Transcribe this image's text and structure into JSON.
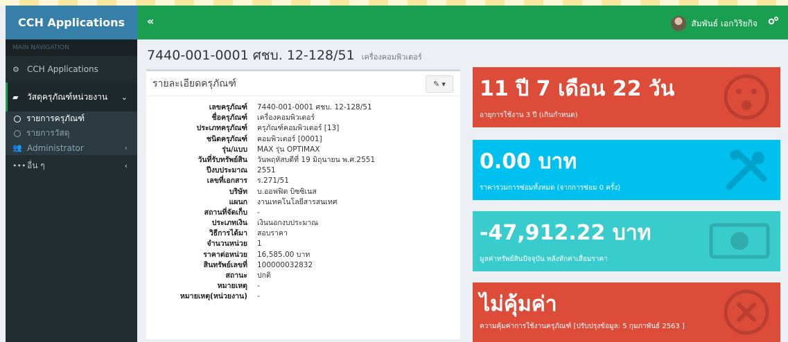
{
  "app": {
    "title": "CCH Applications",
    "toggle_icon": "angle-double-left-icon"
  },
  "header": {
    "user_name": "สัมพันธ์ เอกวิริยกิจ"
  },
  "sidebar": {
    "header": "MAIN NAVIGATION",
    "items": [
      {
        "label": "CCH Applications"
      },
      {
        "label": "วัสดุครุภัณฑ์หน่วยงาน"
      },
      {
        "label": "Administrator"
      },
      {
        "label": "อื่น ๆ"
      }
    ],
    "sub_items": [
      {
        "label": "รายการครุภัณฑ์"
      },
      {
        "label": "รายการวัสดุ"
      }
    ]
  },
  "page": {
    "title": "7440-001-0001 ศชบ. 12-128/51",
    "subtitle": "เครื่องคอมพิวเตอร์"
  },
  "details_box": {
    "title": "รายละเอียดครุภัณฑ์",
    "rows": [
      {
        "label": "เลขครุภัณฑ์",
        "value": "7440-001-0001 ศชบ. 12-128/51"
      },
      {
        "label": "ชื่อครุภัณฑ์",
        "value": "เครื่องคอมพิวเตอร์"
      },
      {
        "label": "ประเภทครุภัณฑ์",
        "value": "ครุภัณฑ์คอมพิวเตอร์ [13]"
      },
      {
        "label": "ชนิดครุภัณฑ์",
        "value": "คอมพิวเตอร์ [0001]"
      },
      {
        "label": "รุ่น/แบบ",
        "value": "MAX รุ่น OPTIMAX"
      },
      {
        "label": "วันที่รับทรัพย์สิน",
        "value": "วันพฤหัสบดีที่ 19 มิถุนายน พ.ศ.2551"
      },
      {
        "label": "ปีงบประมาณ",
        "value": "2551"
      },
      {
        "label": "เลขที่เอกสาร",
        "value": "ร.271/51"
      },
      {
        "label": "บริษัท",
        "value": "บ.ออฟฟิต บิซซิเนส"
      },
      {
        "label": "แผนก",
        "value": "งานเทคโนโลยีสารสนเทศ"
      },
      {
        "label": "สถานที่จัดเก็บ",
        "value": "-"
      },
      {
        "label": "ประเภทเงิน",
        "value": "เงินนอกงบประมาณ"
      },
      {
        "label": "วิธีการได้มา",
        "value": "สอบราคา"
      },
      {
        "label": "จำนวนหน่วย",
        "value": "1"
      },
      {
        "label": "ราคาต่อหน่วย",
        "value": "16,585.00 บาท"
      },
      {
        "label": "สินทรัพย์เลขที่",
        "value": "100000032832"
      },
      {
        "label": "สถานะ",
        "value": "ปกติ"
      },
      {
        "label": "หมายเหตุ",
        "value": "-"
      },
      {
        "label": "หมายเหตุ(หน่วยงาน)",
        "value": "-"
      }
    ]
  },
  "stats": [
    {
      "big": "11 ปี 7 เดือน 22 วัน",
      "sub": "อายุการใช้งาน 3 ปี (เกินกำหนด)",
      "icon": "surprised-face-icon",
      "color": "#dd4b39"
    },
    {
      "big": "0.00 บาท",
      "sub": "ราคารวมการซ่อมทั้งหมด (จากการซ่อม 0 ครั้ง)",
      "icon": "wrench-screwdriver-icon",
      "color": "#00c0ef"
    },
    {
      "big": "-47,912.22 บาท",
      "sub": "มูลค่าทรัพย์สินปัจจุบัน หลังหักค่าเสื่อมราคา",
      "icon": "money-bill-icon",
      "color": "#39cccc"
    },
    {
      "big": "ไม่คุ้มค่า",
      "sub": "ความคุ้มค่าการใช้งานครุภัณฑ์ [ปรับปรุงข้อมูล: 5 กุมภาพันธ์ 2563 ]",
      "icon": "times-circle-icon",
      "color": "#dd4b39"
    }
  ]
}
